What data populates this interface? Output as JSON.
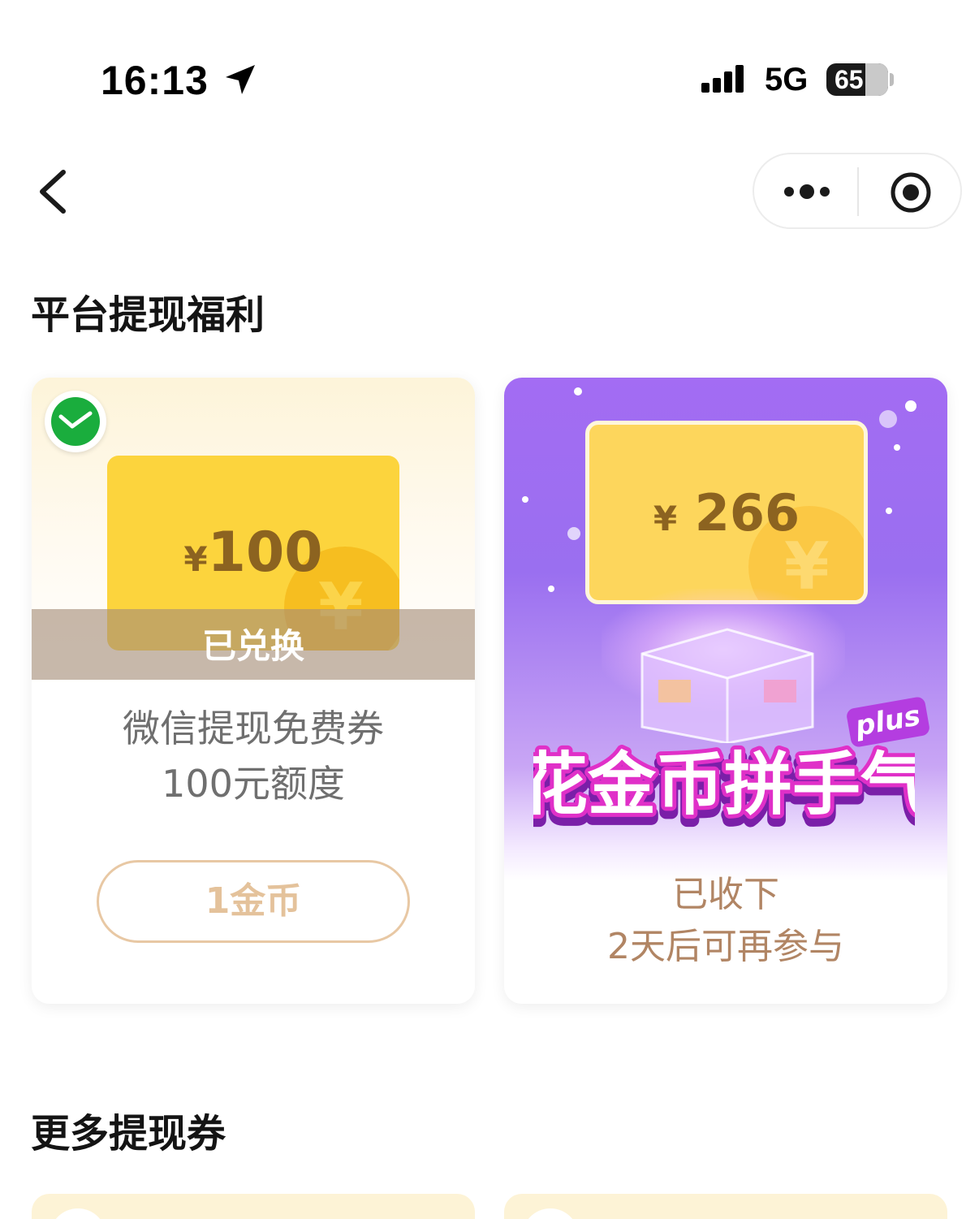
{
  "status_bar": {
    "time": "16:13",
    "network": "5G",
    "battery_level": "65"
  },
  "sections": {
    "platform_title": "平台提现福利",
    "more_title": "更多提现券"
  },
  "cards": {
    "left": {
      "currency_symbol": "¥",
      "amount": "100",
      "status_overlay": "已兑换",
      "desc_line1": "微信提现免费券",
      "desc_line2": "100元额度",
      "button_label": "1金币"
    },
    "right": {
      "currency_symbol": "¥",
      "amount": "266",
      "promo_title": "花金币拼手气",
      "promo_tag": "plus",
      "status_line1": "已收下",
      "status_line2": "2天后可再参与"
    }
  },
  "icons": {
    "location": "location-arrow-icon",
    "signal": "signal-bars-icon",
    "back": "chevron-left-icon",
    "more": "more-dots-icon",
    "close": "target-circle-icon",
    "wechat": "wechat-pay-icon"
  },
  "colors": {
    "coupon_yellow": "#fcd43d",
    "amount_brown": "#8c6320",
    "button_border": "#e8c8a4",
    "promo_purple": "#a36cf3",
    "status_brown": "#b18564"
  }
}
